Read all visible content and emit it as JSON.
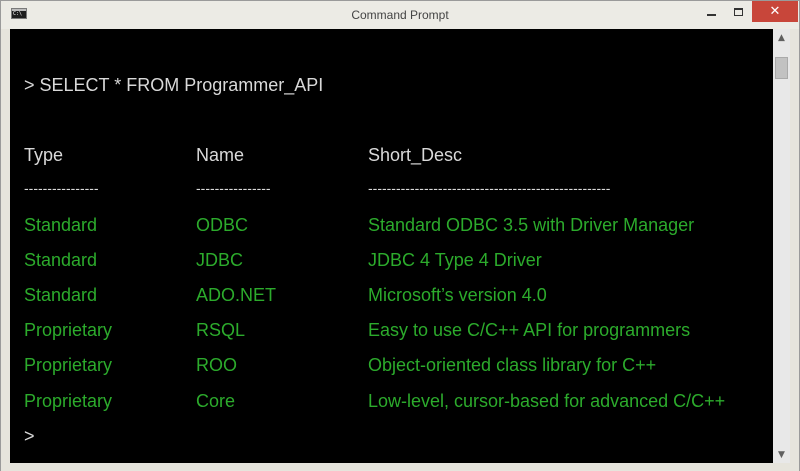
{
  "window": {
    "title": "Command Prompt",
    "close_glyph": "✕"
  },
  "console": {
    "command": "> SELECT * FROM Programmer_API",
    "headers": [
      "Type",
      "Name",
      "Short_Desc"
    ],
    "separators": [
      "----------------",
      "----------------",
      "----------------------------------------------------"
    ],
    "rows": [
      {
        "type": "Standard",
        "name": "ODBC",
        "desc": "Standard ODBC 3.5 with Driver Manager"
      },
      {
        "type": "Standard",
        "name": "JDBC",
        "desc": "JDBC 4 Type 4 Driver"
      },
      {
        "type": "Standard",
        "name": "ADO.NET",
        "desc": "Microsoft’s version 4.0"
      },
      {
        "type": "Proprietary",
        "name": "RSQL",
        "desc": "Easy to use C/C++ API for programmers"
      },
      {
        "type": "Proprietary",
        "name": "ROO",
        "desc": "Object-oriented class library for C++"
      },
      {
        "type": "Proprietary",
        "name": "Core",
        "desc": "Low-level, cursor-based for advanced C/C++"
      }
    ],
    "prompt": ">"
  },
  "scrollbar": {
    "up_glyph": "▲",
    "down_glyph": "▼"
  },
  "colors": {
    "background": "#000000",
    "text_white": "#d9d9d9",
    "text_green": "#2cab2c",
    "close_button": "#c8463a"
  },
  "icons": [
    "console-app-icon",
    "minimize-icon",
    "maximize-icon",
    "close-icon",
    "scroll-up-icon",
    "scroll-down-icon"
  ]
}
